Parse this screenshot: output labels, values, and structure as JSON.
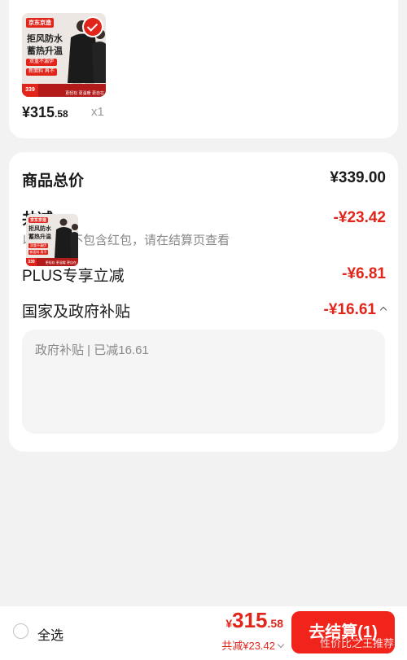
{
  "colors": {
    "accent": "#e1251b",
    "background": "#f2f2f2",
    "card": "#ffffff",
    "muted": "#888888"
  },
  "product": {
    "thumbnail": {
      "brand_tag": "京东京造",
      "headline_line1": "拒风防水",
      "headline_line2": "蓄热升温",
      "feature_1": "双重不漏伊",
      "feature_2": "新面料 再不",
      "price": "339",
      "bottom_text": "更轻松 更温暖 更自在",
      "selected_icon": "check-icon"
    },
    "price_int": "¥315",
    "price_cents": ".58",
    "quantity": "x1"
  },
  "summary": {
    "total_label": "商品总价",
    "total_value": "¥339.00",
    "discount_label": "共减",
    "discount_value": "-¥23.42",
    "discount_note": "以下优惠不包含红包，请在结算页查看",
    "plus_label": "PLUS专享立减",
    "plus_value": "-¥6.81",
    "subsidy_label": "国家及政府补贴",
    "subsidy_value": "-¥16.61",
    "subsidy_toggle_icon": "chevron-up-icon",
    "subsidy_panel_title": "政府补贴 | 已减16.61"
  },
  "bottom_bar": {
    "select_all_label": "全选",
    "total_symbol": "¥",
    "total_int": "315",
    "total_cents": ".58",
    "total_discount": "共减¥23.42",
    "details_icon": "chevron-down-icon",
    "checkout_label": "去结算(1)",
    "watermark": "性价比之王推荐"
  }
}
